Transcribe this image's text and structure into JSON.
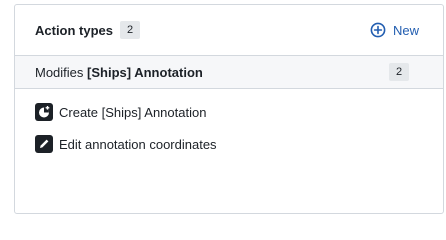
{
  "panel": {
    "title": "Action types",
    "count": "2",
    "new_label": "New"
  },
  "group": {
    "prefix": "Modifies ",
    "name": "[Ships] Annotation",
    "count": "2"
  },
  "items": [
    {
      "label": "Create [Ships] Annotation",
      "icon": "new-object-icon"
    },
    {
      "label": "Edit annotation coordinates",
      "icon": "edit-icon"
    }
  ],
  "colors": {
    "accent": "#215db0",
    "icon_bg": "#1c2127",
    "group_bg": "#f6f7f9",
    "border": "#d3d8de"
  }
}
